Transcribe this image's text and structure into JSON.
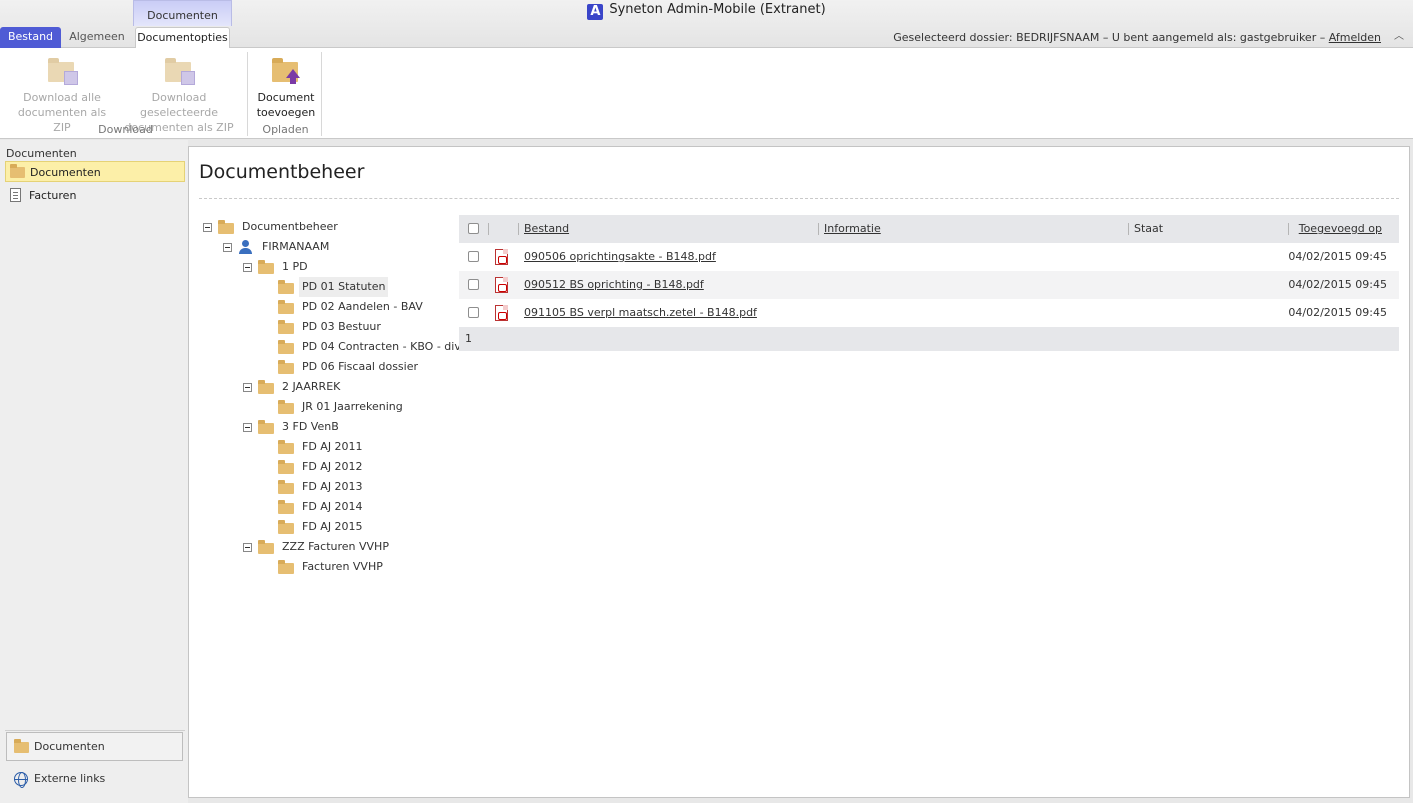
{
  "window": {
    "title": "Syneton Admin-Mobile (Extranet)",
    "logo_letter": "A"
  },
  "ribbon_tabs": {
    "context_group": "Documenten",
    "bestand": "Bestand",
    "algemeen": "Algemeen",
    "documentopties": "Documentopties"
  },
  "status": {
    "prefix": "Geselecteerd dossier: BEDRIJFSNAAM – U bent aangemeld als: gastgebruiker –",
    "logout": "Afmelden"
  },
  "ribbon": {
    "download_group_label": "Download",
    "download_all_line1": "Download alle",
    "download_all_line2": "documenten als ZIP",
    "download_selected_line1": "Download geselecteerde",
    "download_selected_line2": "documenten als ZIP",
    "upload_group_label": "Opladen",
    "add_doc_line1": "Document",
    "add_doc_line2": "toevoegen"
  },
  "sidebar": {
    "heading": "Documenten",
    "items": [
      {
        "label": "Documenten"
      },
      {
        "label": "Facturen"
      }
    ],
    "bottom_documents": "Documenten",
    "bottom_links": "Externe links"
  },
  "main": {
    "title": "Documentbeheer"
  },
  "tree": [
    {
      "label": "Documentbeheer"
    },
    {
      "label": "FIRMANAAM"
    },
    {
      "label": "1 PD"
    },
    {
      "label": "PD 01 Statuten"
    },
    {
      "label": "PD 02 Aandelen - BAV"
    },
    {
      "label": "PD 03 Bestuur"
    },
    {
      "label": "PD 04 Contracten - KBO - div"
    },
    {
      "label": "PD 06 Fiscaal dossier"
    },
    {
      "label": "2 JAARREK"
    },
    {
      "label": "JR 01 Jaarrekening"
    },
    {
      "label": "3 FD VenB"
    },
    {
      "label": "FD AJ 2011"
    },
    {
      "label": "FD AJ 2012"
    },
    {
      "label": "FD AJ 2013"
    },
    {
      "label": "FD AJ 2014"
    },
    {
      "label": "FD AJ 2015"
    },
    {
      "label": "ZZZ Facturen VVHP"
    },
    {
      "label": "Facturen VVHP"
    }
  ],
  "grid": {
    "columns": {
      "bestand": "Bestand",
      "informatie": "Informatie",
      "staat": "Staat",
      "toegevoegd": "Toegevoegd op"
    },
    "rows": [
      {
        "file": "090506 oprichtingsakte - B148.pdf",
        "info": "",
        "state": "",
        "added": "04/02/2015 09:45"
      },
      {
        "file": "090512 BS oprichting - B148.pdf",
        "info": "",
        "state": "",
        "added": "04/02/2015 09:45"
      },
      {
        "file": "091105 BS verpl maatsch.zetel - B148.pdf",
        "info": "",
        "state": "",
        "added": "04/02/2015 09:45"
      }
    ],
    "page": "1"
  }
}
